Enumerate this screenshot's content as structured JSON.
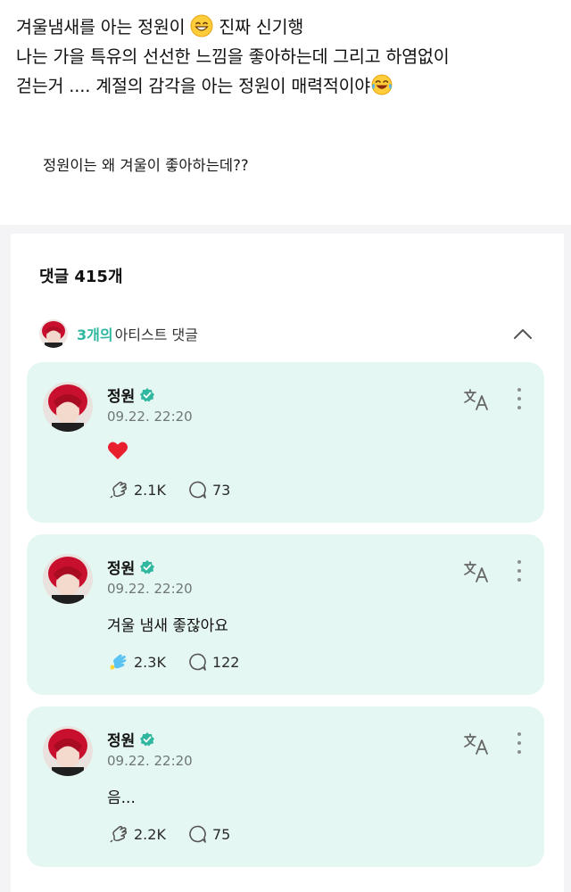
{
  "post": {
    "line1": "겨울냄새를 아는 정원이 😄 진짜 신기행",
    "line1_before": "겨울냄새를 아는 정원이 ",
    "line1_after": " 진짜 신기행",
    "line2": "나는 가을 특유의 선선한 느낌을 좋아하는데 그리고 하염없이",
    "line3_text": "걷는거 .... 계절의 감각을 아는 정원이 매력적이야",
    "question": "정원이는 왜 겨울이 좋아하는데??"
  },
  "comments_section": {
    "title": "댓글 415개",
    "artist_count": "3개의",
    "artist_label": "아티스트 댓글"
  },
  "comments": [
    {
      "name": "정원",
      "time": "09.22. 22:20",
      "content": "",
      "content_type": "heart",
      "likes": "2.1K",
      "replies": "73",
      "liked": false
    },
    {
      "name": "정원",
      "time": "09.22. 22:20",
      "content": "겨울 냄새 좋잖아요",
      "content_type": "text",
      "likes": "2.3K",
      "replies": "122",
      "liked": true
    },
    {
      "name": "정원",
      "time": "09.22. 22:20",
      "content": "음...",
      "content_type": "text",
      "likes": "2.2K",
      "replies": "75",
      "liked": false
    }
  ],
  "icons": {
    "grin": "grinning-face-icon",
    "laugh": "tears-of-joy-icon",
    "verified": "verified-badge-icon",
    "translate": "translate-icon",
    "more": "more-vertical-icon",
    "like": "cheer-icon",
    "reply": "reply-bubble-icon",
    "collapse": "chevron-up-icon"
  },
  "colors": {
    "accent": "#2fb7a0",
    "card_bg": "#e5f7f2",
    "heart": "#e8202e"
  }
}
